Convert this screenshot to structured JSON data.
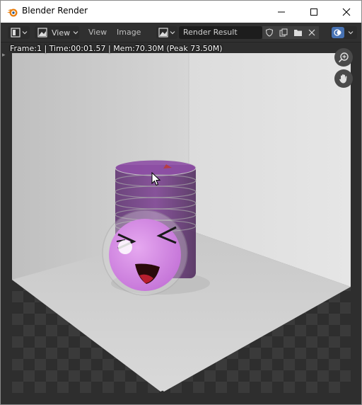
{
  "window": {
    "title": "Blender Render",
    "controls": {
      "minimize": "minimize",
      "maximize": "maximize",
      "close": "close"
    }
  },
  "header": {
    "editor_type_icon": "image-editor-icon",
    "view_mode_label": "View",
    "menus": {
      "view": "View",
      "image": "Image"
    },
    "image_name": "Render Result"
  },
  "stats": {
    "text": "Frame:1 | Time:00:01.57 | Mem:70.30M (Peak 73.50M)"
  },
  "colors": {
    "accent": "#4772b3",
    "header_bg": "#303030",
    "field_bg": "#1d1d1d"
  },
  "icons": [
    "blender-logo-icon",
    "image-editor-icon",
    "image-icon",
    "shield-icon",
    "duplicate-icon",
    "folder-icon",
    "close-icon",
    "overlay-icon",
    "zoom-icon",
    "hand-icon",
    "cursor-icon"
  ]
}
